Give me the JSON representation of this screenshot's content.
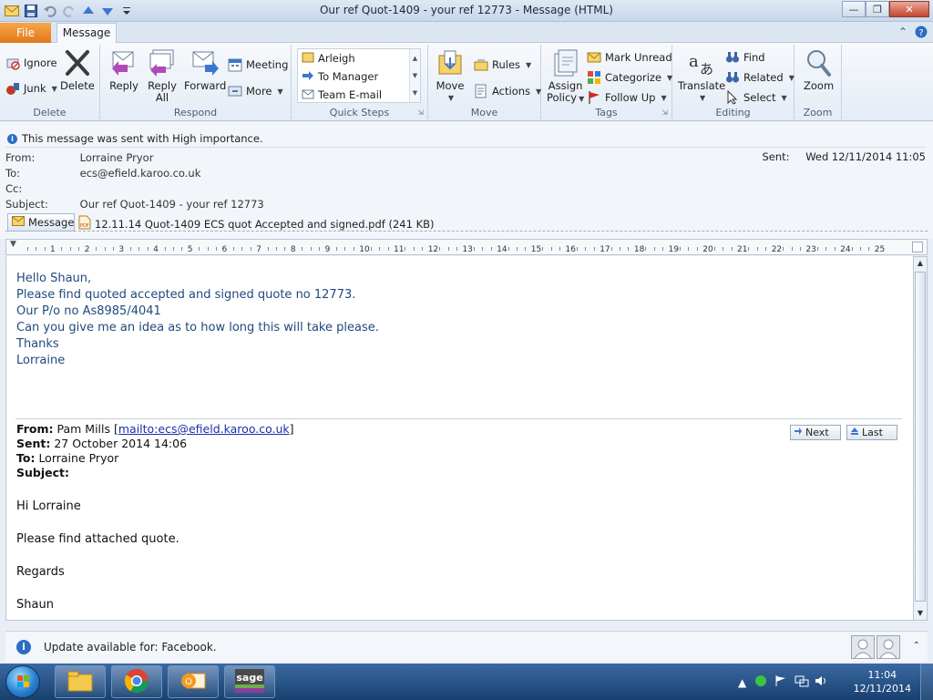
{
  "window": {
    "title": "Our ref Quot-1409 - your ref 12773  -  Message (HTML)"
  },
  "tabs": {
    "file": "File",
    "message": "Message"
  },
  "ribbon": {
    "delete_group": {
      "label": "Delete",
      "ignore": "Ignore",
      "junk": "Junk",
      "delete": "Delete"
    },
    "respond_group": {
      "label": "Respond",
      "reply": "Reply",
      "reply_all_1": "Reply",
      "reply_all_2": "All",
      "forward": "Forward",
      "meeting": "Meeting",
      "more": "More"
    },
    "quicksteps_group": {
      "label": "Quick Steps",
      "items": [
        "Arleigh",
        "To Manager",
        "Team E-mail"
      ]
    },
    "move_group": {
      "label": "Move",
      "move": "Move",
      "rules": "Rules",
      "actions": "Actions"
    },
    "tags_group": {
      "label": "Tags",
      "assign_1": "Assign",
      "assign_2": "Policy",
      "mark_unread": "Mark Unread",
      "categorize": "Categorize",
      "follow_up": "Follow Up"
    },
    "editing_group": {
      "label": "Editing",
      "translate": "Translate",
      "find": "Find",
      "related": "Related",
      "select": "Select"
    },
    "zoom_group": {
      "label": "Zoom",
      "zoom": "Zoom"
    }
  },
  "header": {
    "importance": "This message was sent with High importance.",
    "from_label": "From:",
    "from": "Lorraine Pryor",
    "to_label": "To:",
    "to": "ecs@efield.karoo.co.uk",
    "cc_label": "Cc:",
    "cc": "",
    "subject_label": "Subject:",
    "subject": "Our ref Quot-1409 - your ref 12773",
    "sent_label": "Sent:",
    "sent": "Wed 12/11/2014 11:05",
    "message_chip": "Message",
    "attachment": "12.11.14 Quot-1409 ECS quot Accepted and signed.pdf (241 KB)"
  },
  "ruler": {
    "numbers": [
      "1",
      "2",
      "3",
      "4",
      "5",
      "6",
      "7",
      "8",
      "9",
      "10",
      "11",
      "12",
      "13",
      "14",
      "15",
      "16",
      "17",
      "18",
      "19",
      "20",
      "21",
      "22",
      "23",
      "24",
      "25"
    ]
  },
  "reply": {
    "lines": [
      "Hello Shaun,",
      "Please find quoted accepted and signed quote no 12773.",
      "Our P/o no As8985/4041",
      "Can you give me an idea as to how long this will take please.",
      "Thanks",
      "Lorraine"
    ]
  },
  "original": {
    "from_label": "From:",
    "from_name": "Pam Mills",
    "from_link": "mailto:ecs@efield.karoo.co.uk",
    "sent_label": "Sent:",
    "sent": "27 October 2014 14:06",
    "to_label": "To:",
    "to": "Lorraine Pryor",
    "subject_label": "Subject:",
    "next": "Next",
    "last": "Last",
    "body": [
      "Hi Lorraine",
      "Please find attached quote.",
      "Regards",
      "Shaun"
    ]
  },
  "notification": {
    "text": "Update available for: Facebook."
  },
  "taskbar": {
    "time": "11:04",
    "date": "12/11/2014"
  }
}
